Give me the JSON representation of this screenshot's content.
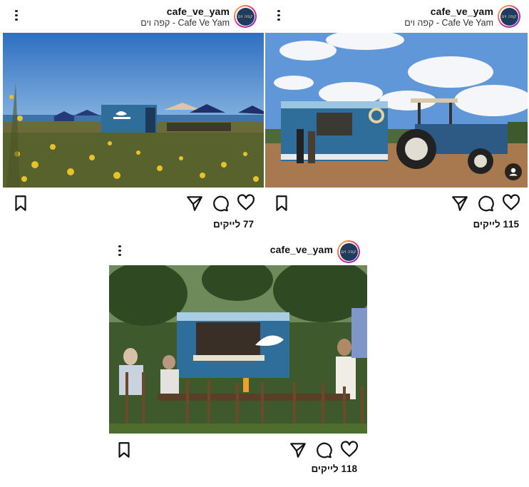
{
  "posts": [
    {
      "username": "cafe_ve_yam",
      "subtitle": "קפה וים - Cafe Ve Yam",
      "avatar_text": "קפה וים",
      "likes": "77 לייקים",
      "icons": [
        "more-vertical-icon",
        "bookmark-icon",
        "send-icon",
        "comment-icon",
        "heart-icon"
      ]
    },
    {
      "username": "cafe_ve_yam",
      "subtitle": "קפה וים - Cafe Ve Yam",
      "avatar_text": "קפה וים",
      "likes": "115 לייקים",
      "icons": [
        "more-vertical-icon",
        "tagged-user-icon",
        "bookmark-icon",
        "send-icon",
        "comment-icon",
        "heart-icon"
      ]
    },
    {
      "username": "cafe_ve_yam",
      "avatar_text": "קפה וים",
      "likes": "118 לייקים",
      "icons": [
        "more-vertical-icon",
        "bookmark-icon",
        "send-icon",
        "comment-icon",
        "heart-icon"
      ]
    }
  ],
  "colors": {
    "avatar_bg": "#1f3c5f",
    "truck_blue": "#2f6e9a",
    "sky": "#4a86c8"
  }
}
